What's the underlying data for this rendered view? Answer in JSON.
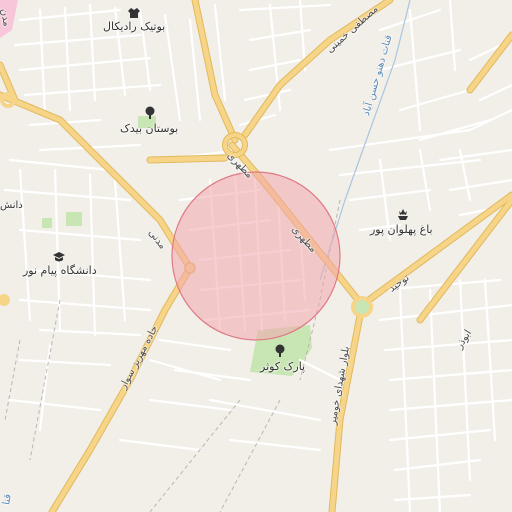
{
  "map": {
    "places": {
      "boutique": "بوتیک رادیکال",
      "park_bidak": "بوستان بیدک",
      "bagh_pahlavan": "باغ پهلوان پور",
      "payam_noor": "دانشگاه پیام نور",
      "park_kowsar": "پارک کوثر",
      "danesh_partial": "دانش"
    },
    "roads": {
      "khomeini": "مصطفی خمینی",
      "motahari_top": "مطهری",
      "motahari_mid": "مطهری",
      "towhid": "توحید",
      "madani": "مدنی",
      "jadeh": "جاده مهریز سوار",
      "blvd_shohada": "بلوار شهدای خومیر",
      "abuzar": "ابوذر",
      "madani_partial": "مدن"
    },
    "waterways": {
      "qanat": "قنات دهنو حسن آباد",
      "qanat_partial": "قنا"
    },
    "colors": {
      "background": "#f2efe9",
      "major_road": "#f6d488",
      "major_road_casing": "#e2b95c",
      "minor_road": "#ffffff",
      "park": "#c8e6b3",
      "accuracy_circle_fill": "#f3a5ad",
      "accuracy_circle_stroke": "#e07a86",
      "commercial_area": "#f7c6d9"
    },
    "icons": {
      "boutique": "shirt-icon",
      "parks": "tree-icon",
      "garden": "garden-icon",
      "university": "graduation-cap-icon"
    }
  }
}
